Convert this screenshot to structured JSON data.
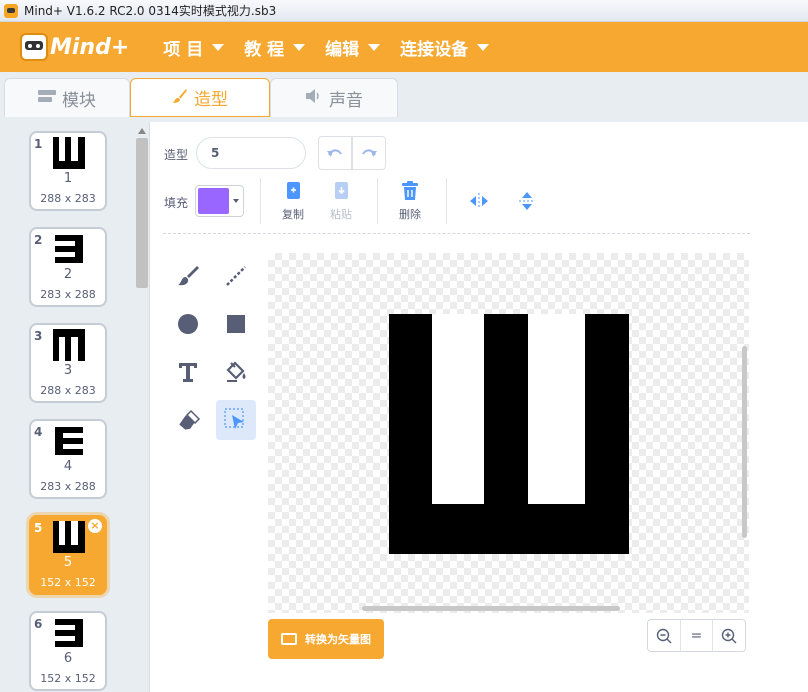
{
  "window": {
    "title": "Mind+ V1.6.2 RC2.0   0314实时模式视力.sb3"
  },
  "menubar": {
    "logo_text": "Mind+",
    "items": [
      "项 目",
      "教 程",
      "编辑",
      "连接设备"
    ]
  },
  "tabs": [
    {
      "label": "模块",
      "icon": "blocks-icon"
    },
    {
      "label": "造型",
      "icon": "paintbrush-icon"
    },
    {
      "label": "声音",
      "icon": "speaker-icon"
    }
  ],
  "costumes": [
    {
      "index": "1",
      "name": "1",
      "size": "288 x 283",
      "glyph": "ш",
      "selected": false
    },
    {
      "index": "2",
      "name": "2",
      "size": "283 x 288",
      "glyph": "э",
      "selected": false
    },
    {
      "index": "3",
      "name": "3",
      "size": "288 x 283",
      "glyph": "m",
      "selected": false
    },
    {
      "index": "4",
      "name": "4",
      "size": "283 x 288",
      "glyph": "e",
      "selected": false
    },
    {
      "index": "5",
      "name": "5",
      "size": "152 x 152",
      "glyph": "ш",
      "selected": true
    },
    {
      "index": "6",
      "name": "6",
      "size": "152 x 152",
      "glyph": "э",
      "selected": false
    }
  ],
  "editor": {
    "costume_label": "造型",
    "costume_name": "5",
    "fill_label": "填充",
    "fill_color": "#9966ff",
    "copy_label": "复制",
    "paste_label": "粘贴",
    "delete_label": "删除",
    "convert_label": "转换为矢量图",
    "zoom_reset": "="
  },
  "colors": {
    "accent": "#f6a830",
    "selected_tool": "#dde9fb",
    "text": "#575e75"
  }
}
